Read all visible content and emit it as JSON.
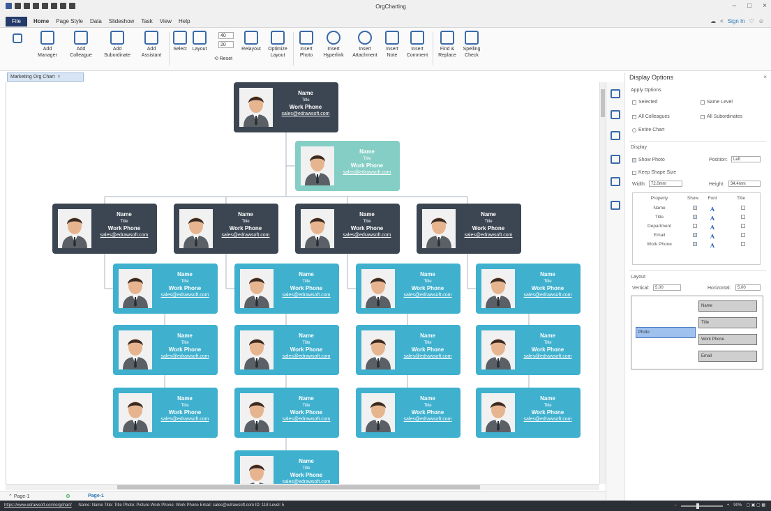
{
  "window": {
    "title": "OrgCharting"
  },
  "menu": {
    "file": "File",
    "tabs": [
      "Home",
      "Page Style",
      "Data",
      "Slideshow",
      "Task",
      "View",
      "Help"
    ],
    "signin": "Sign In"
  },
  "ribbon": {
    "add_manager": [
      "Add",
      "Manager"
    ],
    "add_colleague": [
      "Add",
      "Colleague"
    ],
    "add_subordinate": [
      "Add",
      "Subordinate"
    ],
    "add_assistant": [
      "Add",
      "Assistant"
    ],
    "select": "Select",
    "layout": "Layout",
    "spin1": "40",
    "spin2": "20",
    "reset": "Reset",
    "relayout": "Relayout",
    "optimize_layout": [
      "Optimize",
      "Layout"
    ],
    "insert_photo": [
      "Insert",
      "Photo"
    ],
    "insert_hyperlink": [
      "Insert",
      "Hyperlink"
    ],
    "insert_attachment": [
      "Insert",
      "Attachment"
    ],
    "insert_note": [
      "Insert",
      "Note"
    ],
    "insert_comment": [
      "Insert",
      "Comment"
    ],
    "find_replace": [
      "Find &",
      "Replace"
    ],
    "spelling_check": [
      "Spelling",
      "Check"
    ]
  },
  "doc_tab": {
    "label": "Marketing Org Chart"
  },
  "card": {
    "name": "Name",
    "title": "Title",
    "phone": "Work Phone",
    "email": "sales@edrawsoft.com"
  },
  "pages": {
    "page1": "Page-1",
    "active": "Page-1"
  },
  "status": {
    "url": "https://www.edrawsoft.com/orgchart/",
    "text": "Name: Name  Title: Title  Photo: Picture  Work Phone: Work Phone  Email: sales@edrawsoft.com  ID: 118    Level: 5",
    "zoom": "90%"
  },
  "panel": {
    "title": "Display Options",
    "apply_options": "Apply Options",
    "selected": "Selected",
    "same_level": "Same Level",
    "all_colleagues": "All Colleagues",
    "all_subordinates": "All Subordinates",
    "entire_chart": "Entire Chart",
    "display": "Display",
    "show_photo": "Show Photo",
    "position_label": "Position:",
    "position_value": "Left",
    "keep_shape_size": "Keep Shape Size",
    "width_label": "Width:",
    "width_value": "72.0mm",
    "height_label": "Height:",
    "height_value": "34.4mm",
    "table_headers": [
      "Property",
      "Show",
      "Font",
      "Title"
    ],
    "rows": [
      {
        "property": "Name",
        "show": true,
        "title": false
      },
      {
        "property": "Title",
        "show": true,
        "title": false
      },
      {
        "property": "Department",
        "show": false,
        "title": false
      },
      {
        "property": "Email",
        "show": true,
        "title": false
      },
      {
        "property": "Work Phone",
        "show": true,
        "title": false
      }
    ],
    "layout": "Layout",
    "vertical_label": "Vertical:",
    "vertical_value": "5.00",
    "horizontal_label": "Horizontal:",
    "horizontal_value": "5.00",
    "preview": {
      "name": "Name",
      "title": "Title",
      "photo": "Photo",
      "phone": "Work Phone",
      "email": "Email"
    }
  },
  "colors": {
    "dark_node": "#3c4652",
    "assistant_node": "#84cec5",
    "leaf_node": "#3fb1cf",
    "accent": "#2b79b8"
  }
}
